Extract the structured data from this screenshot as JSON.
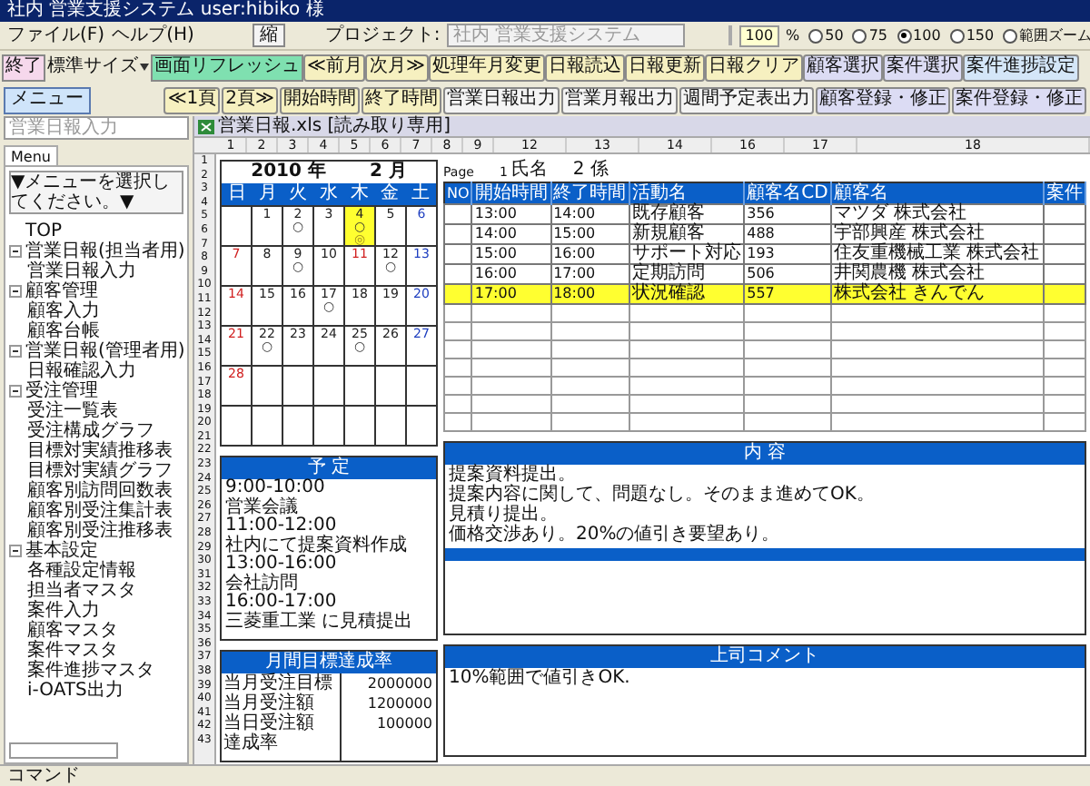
{
  "window": {
    "title": "社内 営業支援システム user:hibiko 様"
  },
  "menu": [
    "ファイル(F)",
    "ヘルプ(H)"
  ],
  "shrink_button": "縮",
  "project": {
    "label": "プロジェクト:",
    "placeholder": "社内 営業支援システム"
  },
  "zoom": {
    "value": "100",
    "unit": "%",
    "options": [
      {
        "label": "50",
        "selected": false
      },
      {
        "label": "75",
        "selected": false
      },
      {
        "label": "100",
        "selected": true
      },
      {
        "label": "150",
        "selected": false
      },
      {
        "label": "範囲ズーム",
        "selected": false
      }
    ]
  },
  "toolbar_left": {
    "exit": "終了",
    "size": "標準サイズ",
    "refresh": "画面リフレッシュ",
    "menu": "メニュー"
  },
  "toolbar_row1": [
    {
      "label": "≪前月",
      "color": "#f6f0c0"
    },
    {
      "label": "次月≫",
      "color": "#f6f0c0"
    },
    {
      "label": "処理年月変更",
      "color": "#f6f0c0"
    },
    {
      "label": "日報読込",
      "color": "#f6f0c0"
    },
    {
      "label": "日報更新",
      "color": "#f6f0c0"
    },
    {
      "label": "日報クリア",
      "color": "#f6f0c0"
    },
    {
      "label": "顧客選択",
      "color": "#dcdcf4"
    },
    {
      "label": "案件選択",
      "color": "#dcdcf4"
    },
    {
      "label": "案件進捗設定",
      "color": "#d4e6f8"
    }
  ],
  "toolbar_row2": [
    {
      "label": "≪1頁",
      "color": "#f6f0c0"
    },
    {
      "label": "2頁≫",
      "color": "#f6f0c0"
    },
    {
      "label": "開始時間",
      "color": "#f6f0c0"
    },
    {
      "label": "終了時間",
      "color": "#f6f0c0"
    },
    {
      "label": "営業日報出力",
      "color": "#f4f4f4"
    },
    {
      "label": "営業月報出力",
      "color": "#f4f4f4"
    },
    {
      "label": "週間予定表出力",
      "color": "#f4f4f4"
    },
    {
      "label": "顧客登録・修正",
      "color": "#dcdcf4"
    },
    {
      "label": "案件登録・修正",
      "color": "#dcdcf4"
    }
  ],
  "sidebar": {
    "field_value": "営業日報入力",
    "tab": "Menu",
    "dropdown": "▼メニューを選択してください。▼",
    "tree": [
      {
        "label": "TOP"
      },
      {
        "label": "営業日報(担当者用)",
        "children": [
          {
            "label": "営業日報入力"
          }
        ]
      },
      {
        "label": "顧客管理",
        "children": [
          {
            "label": "顧客入力"
          },
          {
            "label": "顧客台帳"
          }
        ]
      },
      {
        "label": "営業日報(管理者用)",
        "children": [
          {
            "label": "日報確認入力"
          }
        ]
      },
      {
        "label": "受注管理",
        "children": [
          {
            "label": "受注一覧表"
          },
          {
            "label": "受注構成グラフ"
          },
          {
            "label": "目標対実績推移表"
          },
          {
            "label": "目標対実績グラフ"
          },
          {
            "label": "顧客別訪問回数表"
          },
          {
            "label": "顧客別受注集計表"
          },
          {
            "label": "顧客別受注推移表"
          }
        ]
      },
      {
        "label": "基本設定",
        "children": [
          {
            "label": "各種設定情報"
          },
          {
            "label": "担当者マスタ"
          },
          {
            "label": "案件入力"
          },
          {
            "label": "顧客マスタ"
          },
          {
            "label": "案件マスタ"
          },
          {
            "label": "案件進捗マスタ"
          },
          {
            "label": "i-OATS出力"
          }
        ]
      }
    ]
  },
  "sheet": {
    "title": "営業日報.xls [読み取り専用]",
    "column_headers": [
      "1",
      "2",
      "3",
      "4",
      "5",
      "6",
      "7",
      "8",
      "9",
      "12",
      "13",
      "14",
      "16",
      "17",
      "18"
    ],
    "row_numbers": [
      "1",
      "2",
      "3",
      "4",
      "5",
      "6",
      "7",
      "8",
      "9",
      "10",
      "11",
      "12",
      "13",
      "14",
      "15",
      "16",
      "17",
      "18",
      "19",
      "20",
      "21",
      "22",
      "23",
      "24",
      "25",
      "26",
      "27",
      "28",
      "29",
      "30",
      "31",
      "32",
      "33",
      "34",
      "35",
      "36",
      "37",
      "38",
      "39",
      "40",
      "41",
      "42",
      "43"
    ]
  },
  "calendar": {
    "year": "2010 年",
    "month": "2 月",
    "weekdays": [
      "日",
      "月",
      "火",
      "水",
      "木",
      "金",
      "土"
    ],
    "weeks": [
      [
        {
          "kind": "blank"
        },
        {
          "day": "1",
          "kind": "weekday",
          "selected": false
        },
        {
          "day": "2",
          "kind": "weekday",
          "marks": [
            "○"
          ],
          "selected": false
        },
        {
          "day": "3",
          "kind": "weekday",
          "selected": false
        },
        {
          "day": "4",
          "kind": "weekday",
          "marks": [
            "○",
            "◎"
          ],
          "selected": true
        },
        {
          "day": "5",
          "kind": "weekday",
          "selected": false
        },
        {
          "day": "6",
          "kind": "saturday",
          "selected": false
        }
      ],
      [
        {
          "day": "7",
          "kind": "sunday",
          "selected": false
        },
        {
          "day": "8",
          "kind": "weekday",
          "selected": false
        },
        {
          "day": "9",
          "kind": "weekday",
          "marks": [
            "○"
          ],
          "selected": false
        },
        {
          "day": "10",
          "kind": "weekday",
          "selected": false
        },
        {
          "day": "11",
          "kind": "holiday",
          "selected": false
        },
        {
          "day": "12",
          "kind": "weekday",
          "marks": [
            "○"
          ],
          "selected": false
        },
        {
          "day": "13",
          "kind": "saturday",
          "selected": false
        }
      ],
      [
        {
          "day": "14",
          "kind": "sunday",
          "selected": false
        },
        {
          "day": "15",
          "kind": "weekday",
          "selected": false
        },
        {
          "day": "16",
          "kind": "weekday",
          "selected": false
        },
        {
          "day": "17",
          "kind": "weekday",
          "marks": [
            "○"
          ],
          "selected": false
        },
        {
          "day": "18",
          "kind": "weekday",
          "selected": false
        },
        {
          "day": "19",
          "kind": "weekday",
          "selected": false
        },
        {
          "day": "20",
          "kind": "saturday",
          "selected": false
        }
      ],
      [
        {
          "day": "21",
          "kind": "sunday",
          "selected": false
        },
        {
          "day": "22",
          "kind": "weekday",
          "marks": [
            "○"
          ],
          "selected": false
        },
        {
          "day": "23",
          "kind": "weekday",
          "selected": false
        },
        {
          "day": "24",
          "kind": "weekday",
          "selected": false
        },
        {
          "day": "25",
          "kind": "weekday",
          "marks": [
            "○"
          ],
          "selected": false
        },
        {
          "day": "26",
          "kind": "weekday",
          "selected": false
        },
        {
          "day": "27",
          "kind": "saturday",
          "selected": false
        }
      ],
      [
        {
          "day": "28",
          "kind": "sunday",
          "selected": false
        },
        {
          "kind": "blank"
        },
        {
          "kind": "blank"
        },
        {
          "kind": "blank"
        },
        {
          "kind": "blank"
        },
        {
          "kind": "blank"
        },
        {
          "kind": "blank"
        }
      ],
      [
        {
          "kind": "blank"
        },
        {
          "kind": "blank"
        },
        {
          "kind": "blank"
        },
        {
          "kind": "blank"
        },
        {
          "kind": "blank"
        },
        {
          "kind": "blank"
        },
        {
          "kind": "blank"
        }
      ]
    ]
  },
  "page_info": {
    "page_label": "Page",
    "page": "1",
    "name_label": "氏名",
    "name": "2 係"
  },
  "activities": {
    "columns": [
      "NO",
      "開始時間",
      "終了時間",
      "活動名",
      "顧客名CD",
      "顧客名",
      "案件"
    ],
    "rows": [
      {
        "cells": [
          "",
          "13:00",
          "14:00",
          "既存顧客",
          "356",
          "マツダ 株式会社",
          ""
        ],
        "selected": false
      },
      {
        "cells": [
          "",
          "14:00",
          "15:00",
          "新規顧客",
          "488",
          "宇部興産 株式会社",
          ""
        ],
        "selected": false
      },
      {
        "cells": [
          "",
          "15:00",
          "16:00",
          "サポート対応",
          "193",
          "住友重機械工業 株式会社",
          ""
        ],
        "selected": false
      },
      {
        "cells": [
          "",
          "16:00",
          "17:00",
          "定期訪問",
          "506",
          "井関農機 株式会社",
          ""
        ],
        "selected": false
      },
      {
        "cells": [
          "",
          "17:00",
          "18:00",
          "状況確認",
          "557",
          "株式会社 きんでん",
          ""
        ],
        "selected": true
      }
    ]
  },
  "schedule": {
    "title": "予 定",
    "lines": [
      "9:00-10:00",
      "営業会議",
      "11:00-12:00",
      "社内にて提案資料作成",
      "13:00-16:00",
      "会社訪問",
      "16:00-17:00",
      "三菱重工業 に見積提出"
    ]
  },
  "details": {
    "title": "内 容",
    "lines": [
      "提案資料提出。",
      "提案内容に関して、問題なし。そのまま進めてOK。",
      "見積り提出。",
      "価格交渉あり。20%の値引き要望あり。"
    ]
  },
  "monthly": {
    "title": "月間目標達成率",
    "rows": [
      {
        "label": "当月受注目標",
        "value": "2000000"
      },
      {
        "label": "当月受注額",
        "value": "1200000"
      },
      {
        "label": "当日受注額",
        "value": "100000"
      },
      {
        "label": "達成率"
      }
    ]
  },
  "comment": {
    "title": "上司コメント",
    "lines": [
      "10%範囲で値引きOK."
    ]
  },
  "status_bar": {
    "label": "コマンド"
  }
}
